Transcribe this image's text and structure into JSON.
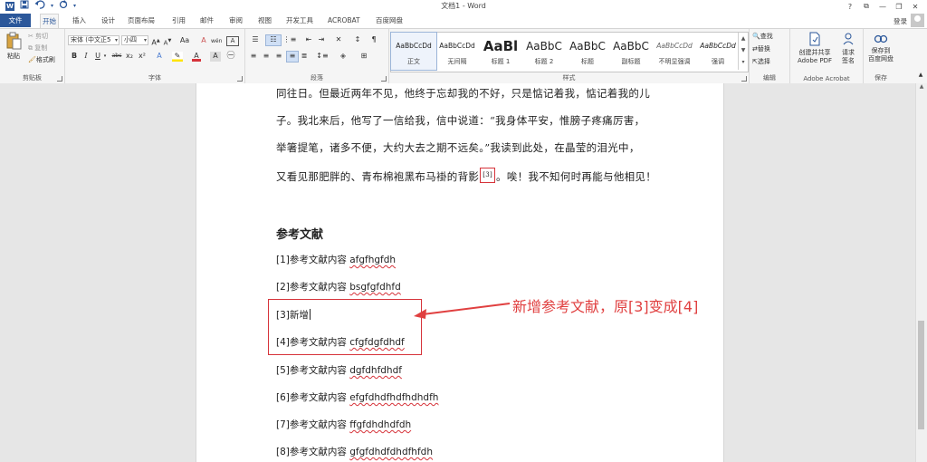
{
  "window": {
    "title": "文档1 - Word",
    "app_icon": "W",
    "controls": [
      "?",
      "⧉",
      "—",
      "❐",
      "✕"
    ]
  },
  "qat": {
    "save_icon": "save-icon",
    "undo_icon": "undo-icon",
    "redo_icon": "redo-icon"
  },
  "tabs": {
    "file": "文件",
    "items": [
      "开始",
      "插入",
      "设计",
      "页面布局",
      "引用",
      "邮件",
      "审阅",
      "视图",
      "开发工具",
      "ACROBAT",
      "百度网盘"
    ],
    "active": "开始",
    "login": "登录"
  },
  "ribbon": {
    "clipboard": {
      "label": "剪贴板",
      "paste": "粘贴",
      "cut": "剪切",
      "copy": "复制",
      "format_painter": "格式刷"
    },
    "font": {
      "label": "字体",
      "font_name": "宋体 (中文正5",
      "font_size": "小四",
      "aa": "Aa",
      "bold": "B",
      "italic": "I",
      "underline": "U",
      "strike": "abc",
      "sub": "x₂",
      "sup": "x²",
      "wen": "wén",
      "a_big": "A",
      "a_small": "A"
    },
    "paragraph": {
      "label": "段落"
    },
    "styles": {
      "label": "样式",
      "items": [
        {
          "preview": "AaBbCcDd",
          "name": "正文"
        },
        {
          "preview": "AaBbCcDd",
          "name": "无间隔"
        },
        {
          "preview": "AaBl",
          "name": "标题 1"
        },
        {
          "preview": "AaBbC",
          "name": "标题 2"
        },
        {
          "preview": "AaBbC",
          "name": "标题"
        },
        {
          "preview": "AaBbC",
          "name": "副标题"
        },
        {
          "preview": "AaBbCcDd",
          "name": "不明显强调"
        },
        {
          "preview": "AaBbCcDd",
          "name": "强调"
        }
      ]
    },
    "editing": {
      "label": "编辑",
      "find": "查找",
      "replace": "替换",
      "select": "选择"
    },
    "acrobat": {
      "label": "Adobe Acrobat",
      "create_pdf_line1": "创建并共享",
      "create_pdf_line2": "Adobe PDF",
      "request_line1": "请求",
      "request_line2": "签名"
    },
    "save": {
      "label": "保存",
      "save_baidu_line1": "保存到",
      "save_baidu_line2": "百度网盘"
    }
  },
  "document": {
    "body_lines": [
      "同往日。但最近两年不见，他终于忘却我的不好，只是惦记着我，惦记着我的儿",
      "子。我北来后，他写了一信给我，信中说道：“我身体平安，惟膀子疼痛厉害，",
      "举箸提笔，诸多不便，大约大去之期不远矣。”我读到此处，在晶莹的泪光中，"
    ],
    "last_line_before": "又看见那肥胖的、青布棉袍黑布马褂的背影",
    "citation": "[3]",
    "last_line_after": "。唉！我不知何时再能与他相见！",
    "references_heading": "参考文献",
    "references": [
      {
        "num": "[1]",
        "text": "参考文献内容",
        "latin": "afgfhgfdh"
      },
      {
        "num": "[2]",
        "text": "参考文献内容",
        "latin": "bsgfgfdhfd"
      },
      {
        "num": "[3]",
        "text": "新增",
        "latin": ""
      },
      {
        "num": "[4]",
        "text": "参考文献内容",
        "latin": "cfgfdgfdhdf"
      },
      {
        "num": "[5]",
        "text": "参考文献内容",
        "latin": "dgfdhfdhdf"
      },
      {
        "num": "[6]",
        "text": "参考文献内容",
        "latin": "efgfdhdfhdfhdhdfh"
      },
      {
        "num": "[7]",
        "text": "参考文献内容",
        "latin": "ffgfdhdhdfdh"
      },
      {
        "num": "[8]",
        "text": "参考文献内容",
        "latin": "gfgfdhdfdhdfhfdh"
      }
    ],
    "annotation": "新增参考文献，原[3]变成[4]"
  },
  "colors": {
    "accent": "#2b579a",
    "annotation_red": "#e04040",
    "box_red": "#d6333a"
  }
}
